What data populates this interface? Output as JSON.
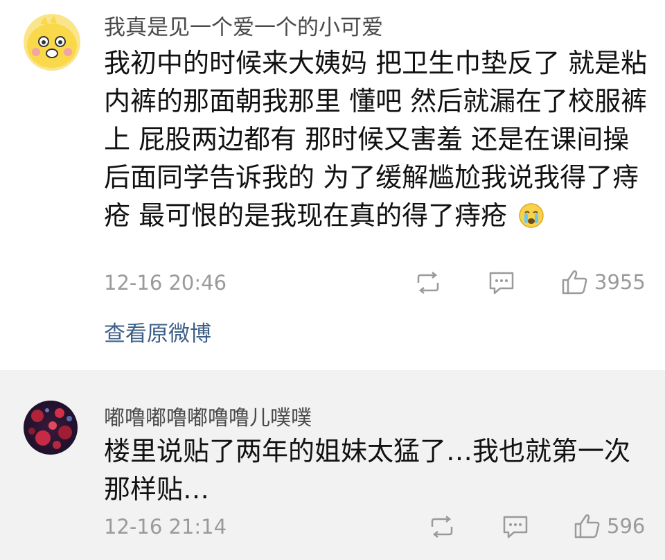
{
  "comments": [
    {
      "username": "我真是见一个爱一个的小可爱",
      "text": "我初中的时候来大姨妈 把卫生巾垫反了 就是粘内裤的那面朝我那里 懂吧 然后就漏在了校服裤上 屁股两边都有 那时候又害羞 还是在课间操后面同学告诉我的 为了缓解尴尬我说我得了痔疮 最可恨的是我现在真的得了痔疮",
      "emoji_icon": "crying-face-emoji",
      "timestamp": "12-16 20:46",
      "likes": "3955",
      "view_source_label": "查看原微博",
      "avatar_icon": "yellow-cartoon-duck-avatar"
    },
    {
      "username": "嘟噜嘟噜嘟噜噜儿噗噗",
      "text": "楼里说贴了两年的姐妹太猛了…我也就第一次那样贴…",
      "timestamp": "12-16 21:14",
      "likes": "596",
      "avatar_icon": "dark-red-pattern-avatar"
    }
  ],
  "icons": {
    "repost": "repost-icon",
    "comment": "comment-icon",
    "like": "thumbs-up-icon"
  },
  "colors": {
    "link": "#3d5f87",
    "meta": "#9a9a9a",
    "second_bg": "#f2f2f2"
  }
}
